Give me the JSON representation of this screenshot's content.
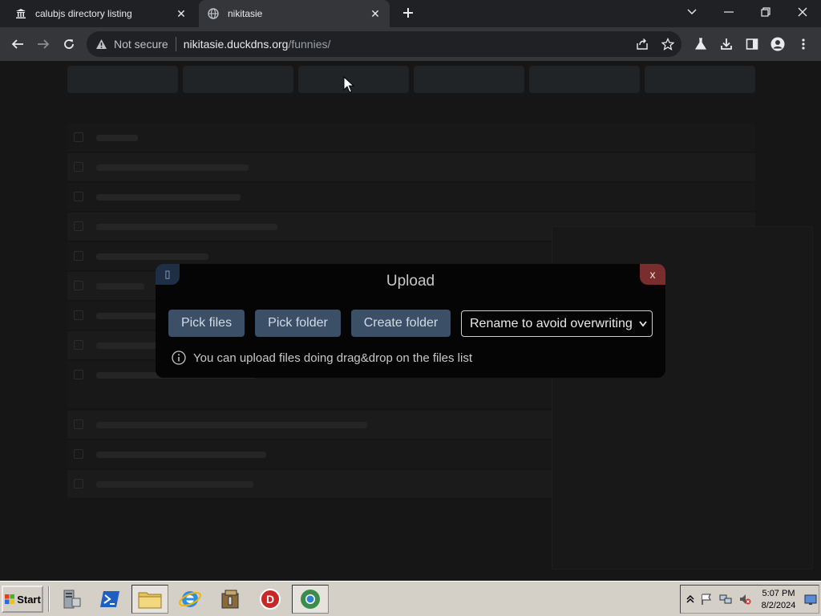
{
  "browser": {
    "tabs": [
      {
        "title": "calubjs directory listing",
        "icon": "bank-icon",
        "active": false
      },
      {
        "title": "nikitasie",
        "icon": "globe-icon",
        "active": true
      }
    ],
    "new_tab_icon": "plus-icon",
    "address": {
      "security_label": "Not secure",
      "host": "nikitasie.duckdns.org",
      "path": "/funnies/"
    }
  },
  "modal": {
    "title": "Upload",
    "pin_icon": "pin-icon",
    "close_label": "x",
    "buttons": {
      "pick_files": "Pick files",
      "pick_folder": "Pick folder",
      "create_folder": "Create folder"
    },
    "mode_select": {
      "selected": "Rename to avoid overwriting"
    },
    "info_text": "You can upload files doing drag&drop on the files list"
  },
  "taskbar": {
    "start_label": "Start",
    "clock_time": "5:07 PM",
    "clock_date": "8/2/2024"
  },
  "colors": {
    "modal_button": "#3b4f66",
    "modal_close": "#7a2d2d",
    "page_background": "#222222"
  }
}
